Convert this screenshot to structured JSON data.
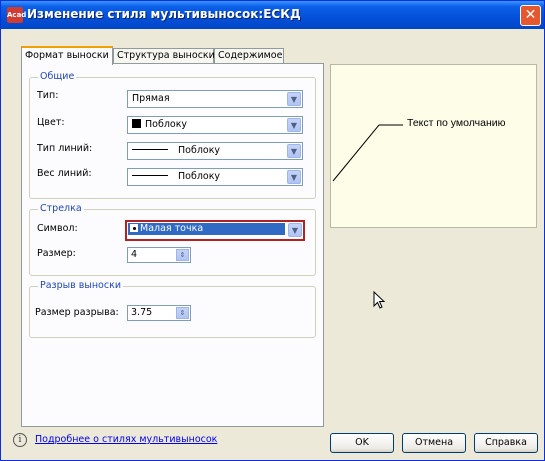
{
  "window": {
    "title": "Изменение стиля мультивыносок:ЕСКД",
    "app_icon_text": "Acad",
    "close_symbol": "✕"
  },
  "tabs": [
    {
      "label": "Формат выноски",
      "active": true
    },
    {
      "label": "Структура выноски",
      "active": false
    },
    {
      "label": "Содержимое",
      "active": false
    }
  ],
  "general": {
    "title": "Общие",
    "type_label": "Тип:",
    "type_value": "Прямая",
    "color_label": "Цвет:",
    "color_value": "Поблоку",
    "linetype_label": "Тип линий:",
    "linetype_value": "Поблоку",
    "lineweight_label": "Вес линий:",
    "lineweight_value": "Поблоку"
  },
  "arrow": {
    "title": "Стрелка",
    "symbol_label": "Символ:",
    "symbol_value": "Малая точка",
    "size_label": "Размер:",
    "size_value": "4"
  },
  "break": {
    "title": "Разрыв выноски",
    "size_label": "Размер разрыва:",
    "size_value": "3.75"
  },
  "preview": {
    "text": "Текст по умолчанию"
  },
  "footer": {
    "info_icon": "i",
    "link": "Подробнее о стилях мультивыносок",
    "ok": "OK",
    "cancel": "Отмена",
    "help": "Справка"
  },
  "icons": {
    "dropdown": "▼",
    "spin": "⇕"
  },
  "colors": {
    "title_bar": "#0550d8",
    "selection": "#316ac5",
    "highlight_border": "#b22222",
    "preview_bg": "#fdfde8",
    "group_title": "#1f47b4"
  }
}
